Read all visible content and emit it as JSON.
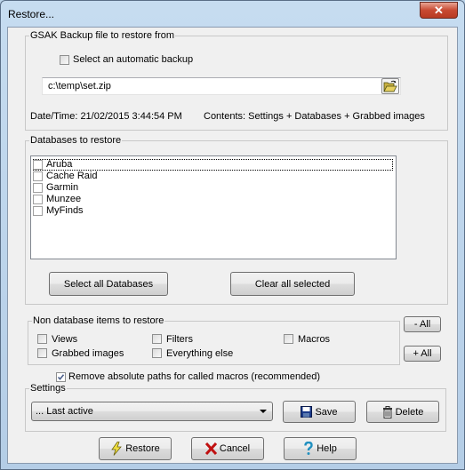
{
  "window": {
    "title": "Restore...",
    "close_label": "✕"
  },
  "backup_group": {
    "label": "GSAK Backup file to restore from",
    "auto_backup_label": "Select an automatic backup",
    "auto_backup_checked": false,
    "file_path": "c:\\temp\\set.zip",
    "datetime_label": "Date/Time: 21/02/2015 3:44:54 PM",
    "contents_label": "Contents: Settings + Databases + Grabbed images"
  },
  "databases_group": {
    "label": "Databases to restore",
    "items": [
      {
        "label": "Aruba",
        "checked": false
      },
      {
        "label": "Cache Raid",
        "checked": false
      },
      {
        "label": "Garmin",
        "checked": false
      },
      {
        "label": "Munzee",
        "checked": false
      },
      {
        "label": "MyFinds",
        "checked": false
      }
    ],
    "select_all_label": "Select all Databases",
    "clear_all_label": "Clear all selected"
  },
  "non_db_group": {
    "label": "Non database items to restore",
    "items": [
      {
        "label": "Views",
        "checked": false
      },
      {
        "label": "Filters",
        "checked": false
      },
      {
        "label": "Macros",
        "checked": false
      },
      {
        "label": "Grabbed images",
        "checked": false
      },
      {
        "label": "Everything else",
        "checked": false
      }
    ],
    "minus_all_label": "- All",
    "plus_all_label": "+ All"
  },
  "remove_paths": {
    "label": "Remove absolute paths for called macros (recommended)",
    "checked": true
  },
  "settings_group": {
    "label": "Settings",
    "selected": "... Last active",
    "save_label": "Save",
    "delete_label": "Delete"
  },
  "footer": {
    "restore_label": "Restore",
    "cancel_label": "Cancel",
    "help_label": "Help"
  }
}
